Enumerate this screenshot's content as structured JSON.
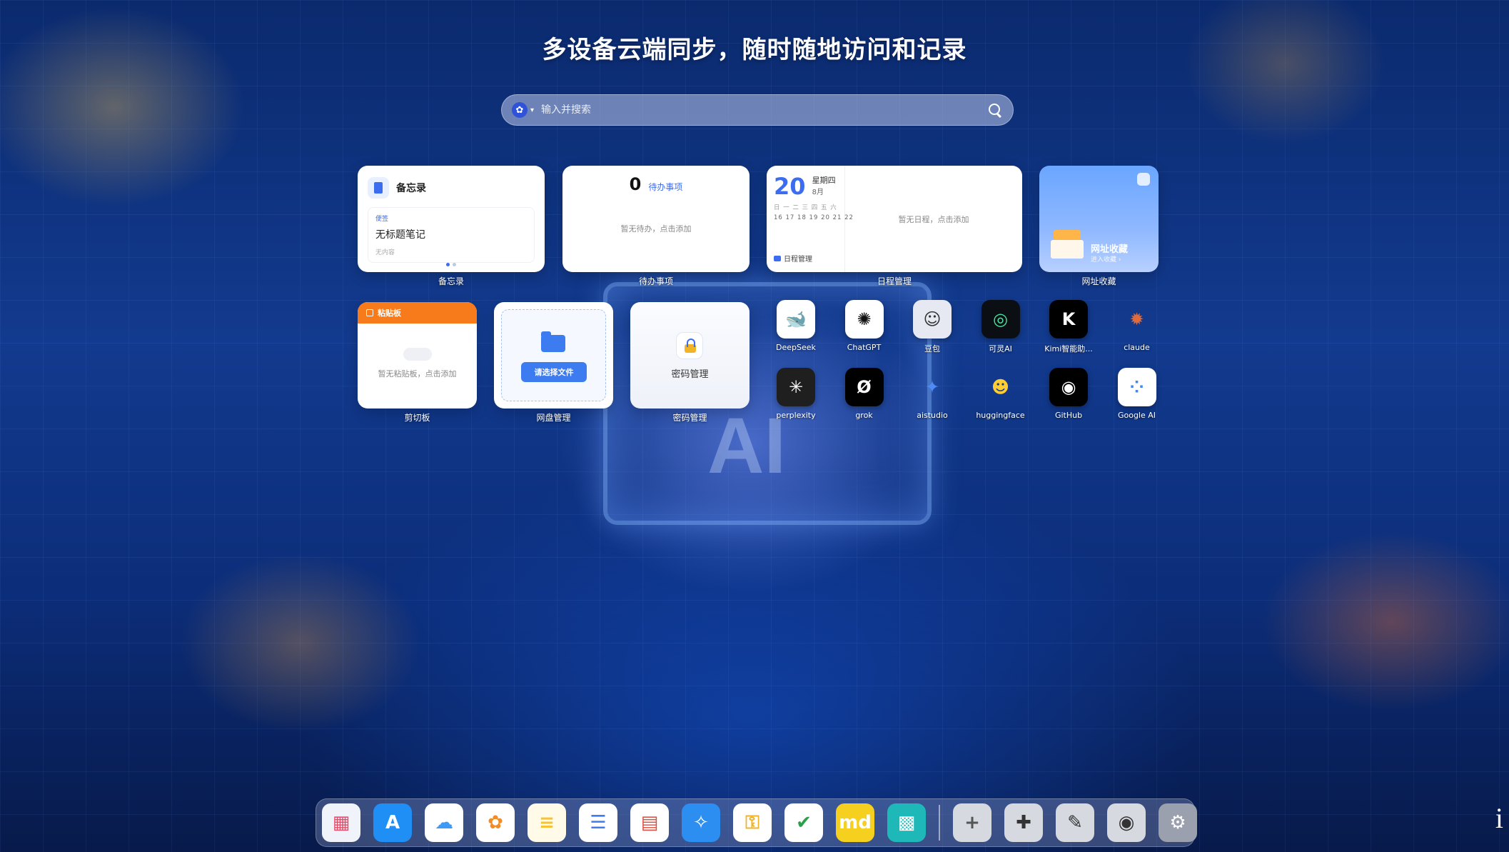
{
  "headline": "多设备云端同步，随时随地访问和记录",
  "search": {
    "placeholder": "输入并搜索",
    "engine_icon": "baidu-paw-icon"
  },
  "widgets": {
    "memo": {
      "title": "备忘录",
      "tag": "便签",
      "note_title": "无标题笔记",
      "note_content": "无内容",
      "caption": "备忘录"
    },
    "todo": {
      "count": "0",
      "label": "待办事项",
      "empty": "暂无待办，点击添加",
      "caption": "待办事项"
    },
    "calendar": {
      "day": "20",
      "weekday": "星期四",
      "month": "8月",
      "week_header": "日 一 二 三 四 五 六",
      "week_days": "16 17 18 19 20 21 22",
      "schedule_label": "日程管理",
      "empty": "暂无日程，点击添加",
      "caption": "日程管理"
    },
    "bookmarks": {
      "title": "网址收藏",
      "subtitle": "进入收藏 ›",
      "caption": "网址收藏"
    },
    "clipboard": {
      "title": "粘贴板",
      "empty": "暂无粘贴板，点击添加",
      "caption": "剪切板"
    },
    "disk": {
      "button": "请选择文件",
      "caption": "网盘管理"
    },
    "password": {
      "label": "密码管理",
      "caption": "密码管理"
    }
  },
  "apps": [
    {
      "name": "DeepSeek",
      "icon": "deepseek-icon",
      "bg": "#ffffff",
      "fg": "#4d6bfe",
      "glyph": "🐋"
    },
    {
      "name": "ChatGPT",
      "icon": "chatgpt-icon",
      "bg": "#ffffff",
      "fg": "#111111",
      "glyph": "✺"
    },
    {
      "name": "豆包",
      "icon": "doubao-icon",
      "bg": "#e6e9f2",
      "fg": "#333333",
      "glyph": "☺"
    },
    {
      "name": "可灵AI",
      "icon": "kling-icon",
      "bg": "#0b0f14",
      "fg": "#47e5a0",
      "glyph": "◎"
    },
    {
      "name": "Kimi智能助...",
      "icon": "kimi-icon",
      "bg": "#000000",
      "fg": "#ffffff",
      "glyph": "K"
    },
    {
      "name": "claude",
      "icon": "claude-icon",
      "bg": "transparent",
      "fg": "#e06a3a",
      "glyph": "✹"
    },
    {
      "name": "perplexity",
      "icon": "perplexity-icon",
      "bg": "#1f1f1f",
      "fg": "#ffffff",
      "glyph": "✳"
    },
    {
      "name": "grok",
      "icon": "grok-icon",
      "bg": "#000000",
      "fg": "#ffffff",
      "glyph": "Ø"
    },
    {
      "name": "aistudio",
      "icon": "aistudio-icon",
      "bg": "transparent",
      "fg": "#4d8cf5",
      "glyph": "✦"
    },
    {
      "name": "huggingface",
      "icon": "huggingface-icon",
      "bg": "transparent",
      "fg": "#ffcc33",
      "glyph": "☻"
    },
    {
      "name": "GitHub",
      "icon": "github-icon",
      "bg": "#000000",
      "fg": "#ffffff",
      "glyph": "◉"
    },
    {
      "name": "Google AI",
      "icon": "google-ai-icon",
      "bg": "#ffffff",
      "fg": "#4285f4",
      "glyph": "⁘"
    }
  ],
  "dock": [
    {
      "icon": "launchpad-icon",
      "bg": "#f0f3fa",
      "glyph": "▦",
      "fg": "#e94b6a"
    },
    {
      "icon": "app-store-icon",
      "bg": "#1f8ef5",
      "glyph": "A",
      "fg": "#ffffff"
    },
    {
      "icon": "icloud-icon",
      "bg": "#ffffff",
      "glyph": "☁",
      "fg": "#3d9af5"
    },
    {
      "icon": "photos-icon",
      "bg": "#ffffff",
      "glyph": "✿",
      "fg": "#f08c2a"
    },
    {
      "icon": "notes-icon",
      "bg": "#fffbe8",
      "glyph": "≡",
      "fg": "#f5c431"
    },
    {
      "icon": "reminders-icon",
      "bg": "#ffffff",
      "glyph": "☰",
      "fg": "#3c7cf0"
    },
    {
      "icon": "calendar-icon",
      "bg": "#ffffff",
      "glyph": "▤",
      "fg": "#e04a3a"
    },
    {
      "icon": "safari-icon",
      "bg": "#2b8ef0",
      "glyph": "✧",
      "fg": "#ffffff"
    },
    {
      "icon": "passwords-icon",
      "bg": "#ffffff",
      "glyph": "⚿",
      "fg": "#f0b429"
    },
    {
      "icon": "todo-app-icon",
      "bg": "#ffffff",
      "glyph": "✔",
      "fg": "#2aa04a"
    },
    {
      "icon": "markdown-icon",
      "bg": "#f5d01f",
      "glyph": "md",
      "fg": "#ffffff"
    },
    {
      "icon": "qrcode-icon",
      "bg": "#1fb8b8",
      "glyph": "▩",
      "fg": "#ffffff"
    },
    {
      "icon": "separator"
    },
    {
      "icon": "add-icon",
      "bg": "#d6d9e0",
      "glyph": "+",
      "fg": "#555555"
    },
    {
      "icon": "puzzle-icon",
      "bg": "#d6d9e0",
      "glyph": "✚",
      "fg": "#333333"
    },
    {
      "icon": "brush-icon",
      "bg": "#d6d9e0",
      "glyph": "✎",
      "fg": "#333333"
    },
    {
      "icon": "camera-settings-icon",
      "bg": "#d6d9e0",
      "glyph": "◉",
      "fg": "#333333"
    },
    {
      "icon": "settings-icon",
      "bg": "#9aa0ad",
      "glyph": "⚙",
      "fg": "#ffffff"
    }
  ],
  "edge_info": "i"
}
